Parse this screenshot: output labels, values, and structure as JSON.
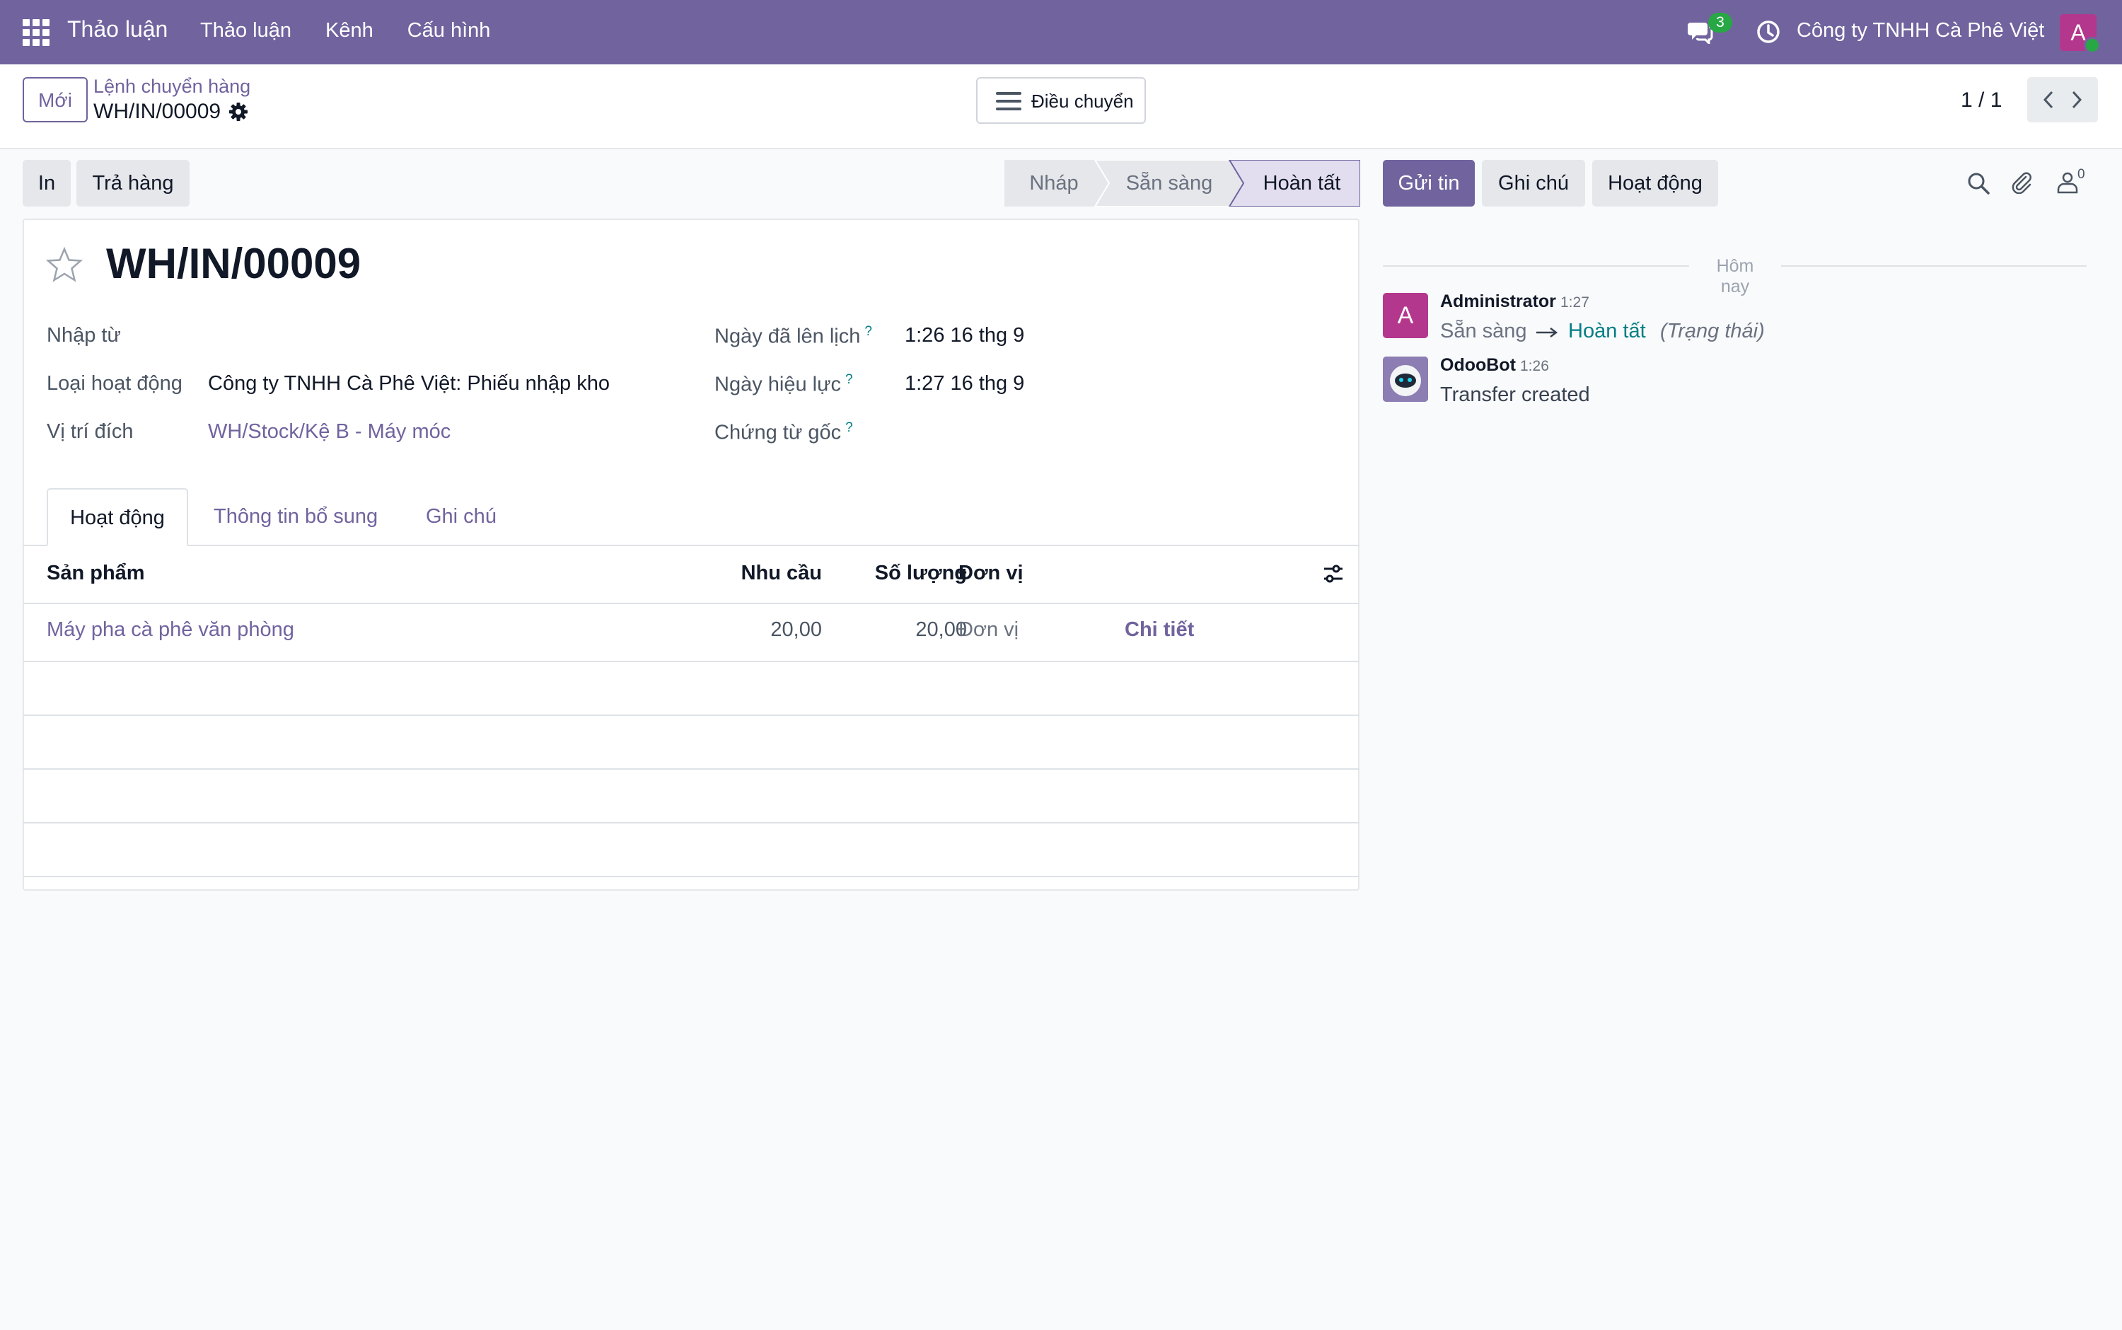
{
  "navbar": {
    "brand": "Thảo luận",
    "menu": [
      "Thảo luận",
      "Kênh",
      "Cấu hình"
    ],
    "chat_badge": "3",
    "company": "Công ty TNHH Cà Phê Việt",
    "avatar_letter": "A",
    "colors": {
      "navbar": "#71639e",
      "avatar": "#b4378e",
      "online": "#28a745"
    }
  },
  "control_panel": {
    "new_button": "Mới",
    "breadcrumb_parent": "Lệnh chuyển hàng",
    "breadcrumb_current": "WH/IN/00009",
    "transfers_button": "Điều chuyển",
    "pager": "1 / 1"
  },
  "actions": {
    "print": "In",
    "return": "Trả hàng"
  },
  "statusbar": {
    "steps": [
      "Nháp",
      "Sẵn sàng",
      "Hoàn tất"
    ],
    "current": "Hoàn tất"
  },
  "form": {
    "title": "WH/IN/00009",
    "left_fields": [
      {
        "label": "Nhập từ",
        "value": ""
      },
      {
        "label": "Loại hoạt động",
        "value": "Công ty TNHH Cà Phê Việt: Phiếu nhập kho"
      },
      {
        "label": "Vị trí đích",
        "value": "WH/Stock/Kệ B - Máy móc"
      }
    ],
    "right_fields": [
      {
        "label": "Ngày đã lên lịch",
        "help": "?",
        "value": "1:26 16 thg 9"
      },
      {
        "label": "Ngày hiệu lực",
        "help": "?",
        "value": "1:27 16 thg 9"
      },
      {
        "label": "Chứng từ gốc",
        "help": "?",
        "value": ""
      }
    ],
    "tabs": [
      "Hoạt động",
      "Thông tin bổ sung",
      "Ghi chú"
    ],
    "table": {
      "headers": [
        "Sản phẩm",
        "Nhu cầu",
        "Số lượng",
        "Đơn vị"
      ],
      "rows": [
        {
          "product": "Máy pha cà phê văn phòng",
          "demand": "20,00",
          "quantity": "20,00",
          "uom": "Đơn vị",
          "details": "Chi tiết"
        }
      ]
    }
  },
  "chatter": {
    "send_button": "Gửi tin",
    "note_button": "Ghi chú",
    "activity_button": "Hoạt động",
    "follower_count": "0",
    "day_separator": "Hôm nay",
    "messages": [
      {
        "author": "Administrator",
        "time": "1:27",
        "avatar_letter": "A",
        "from": "Sẵn sàng",
        "to": "Hoàn tất",
        "field": "(Trạng thái)"
      },
      {
        "author": "OdooBot",
        "time": "1:26",
        "body": "Transfer created"
      }
    ]
  }
}
